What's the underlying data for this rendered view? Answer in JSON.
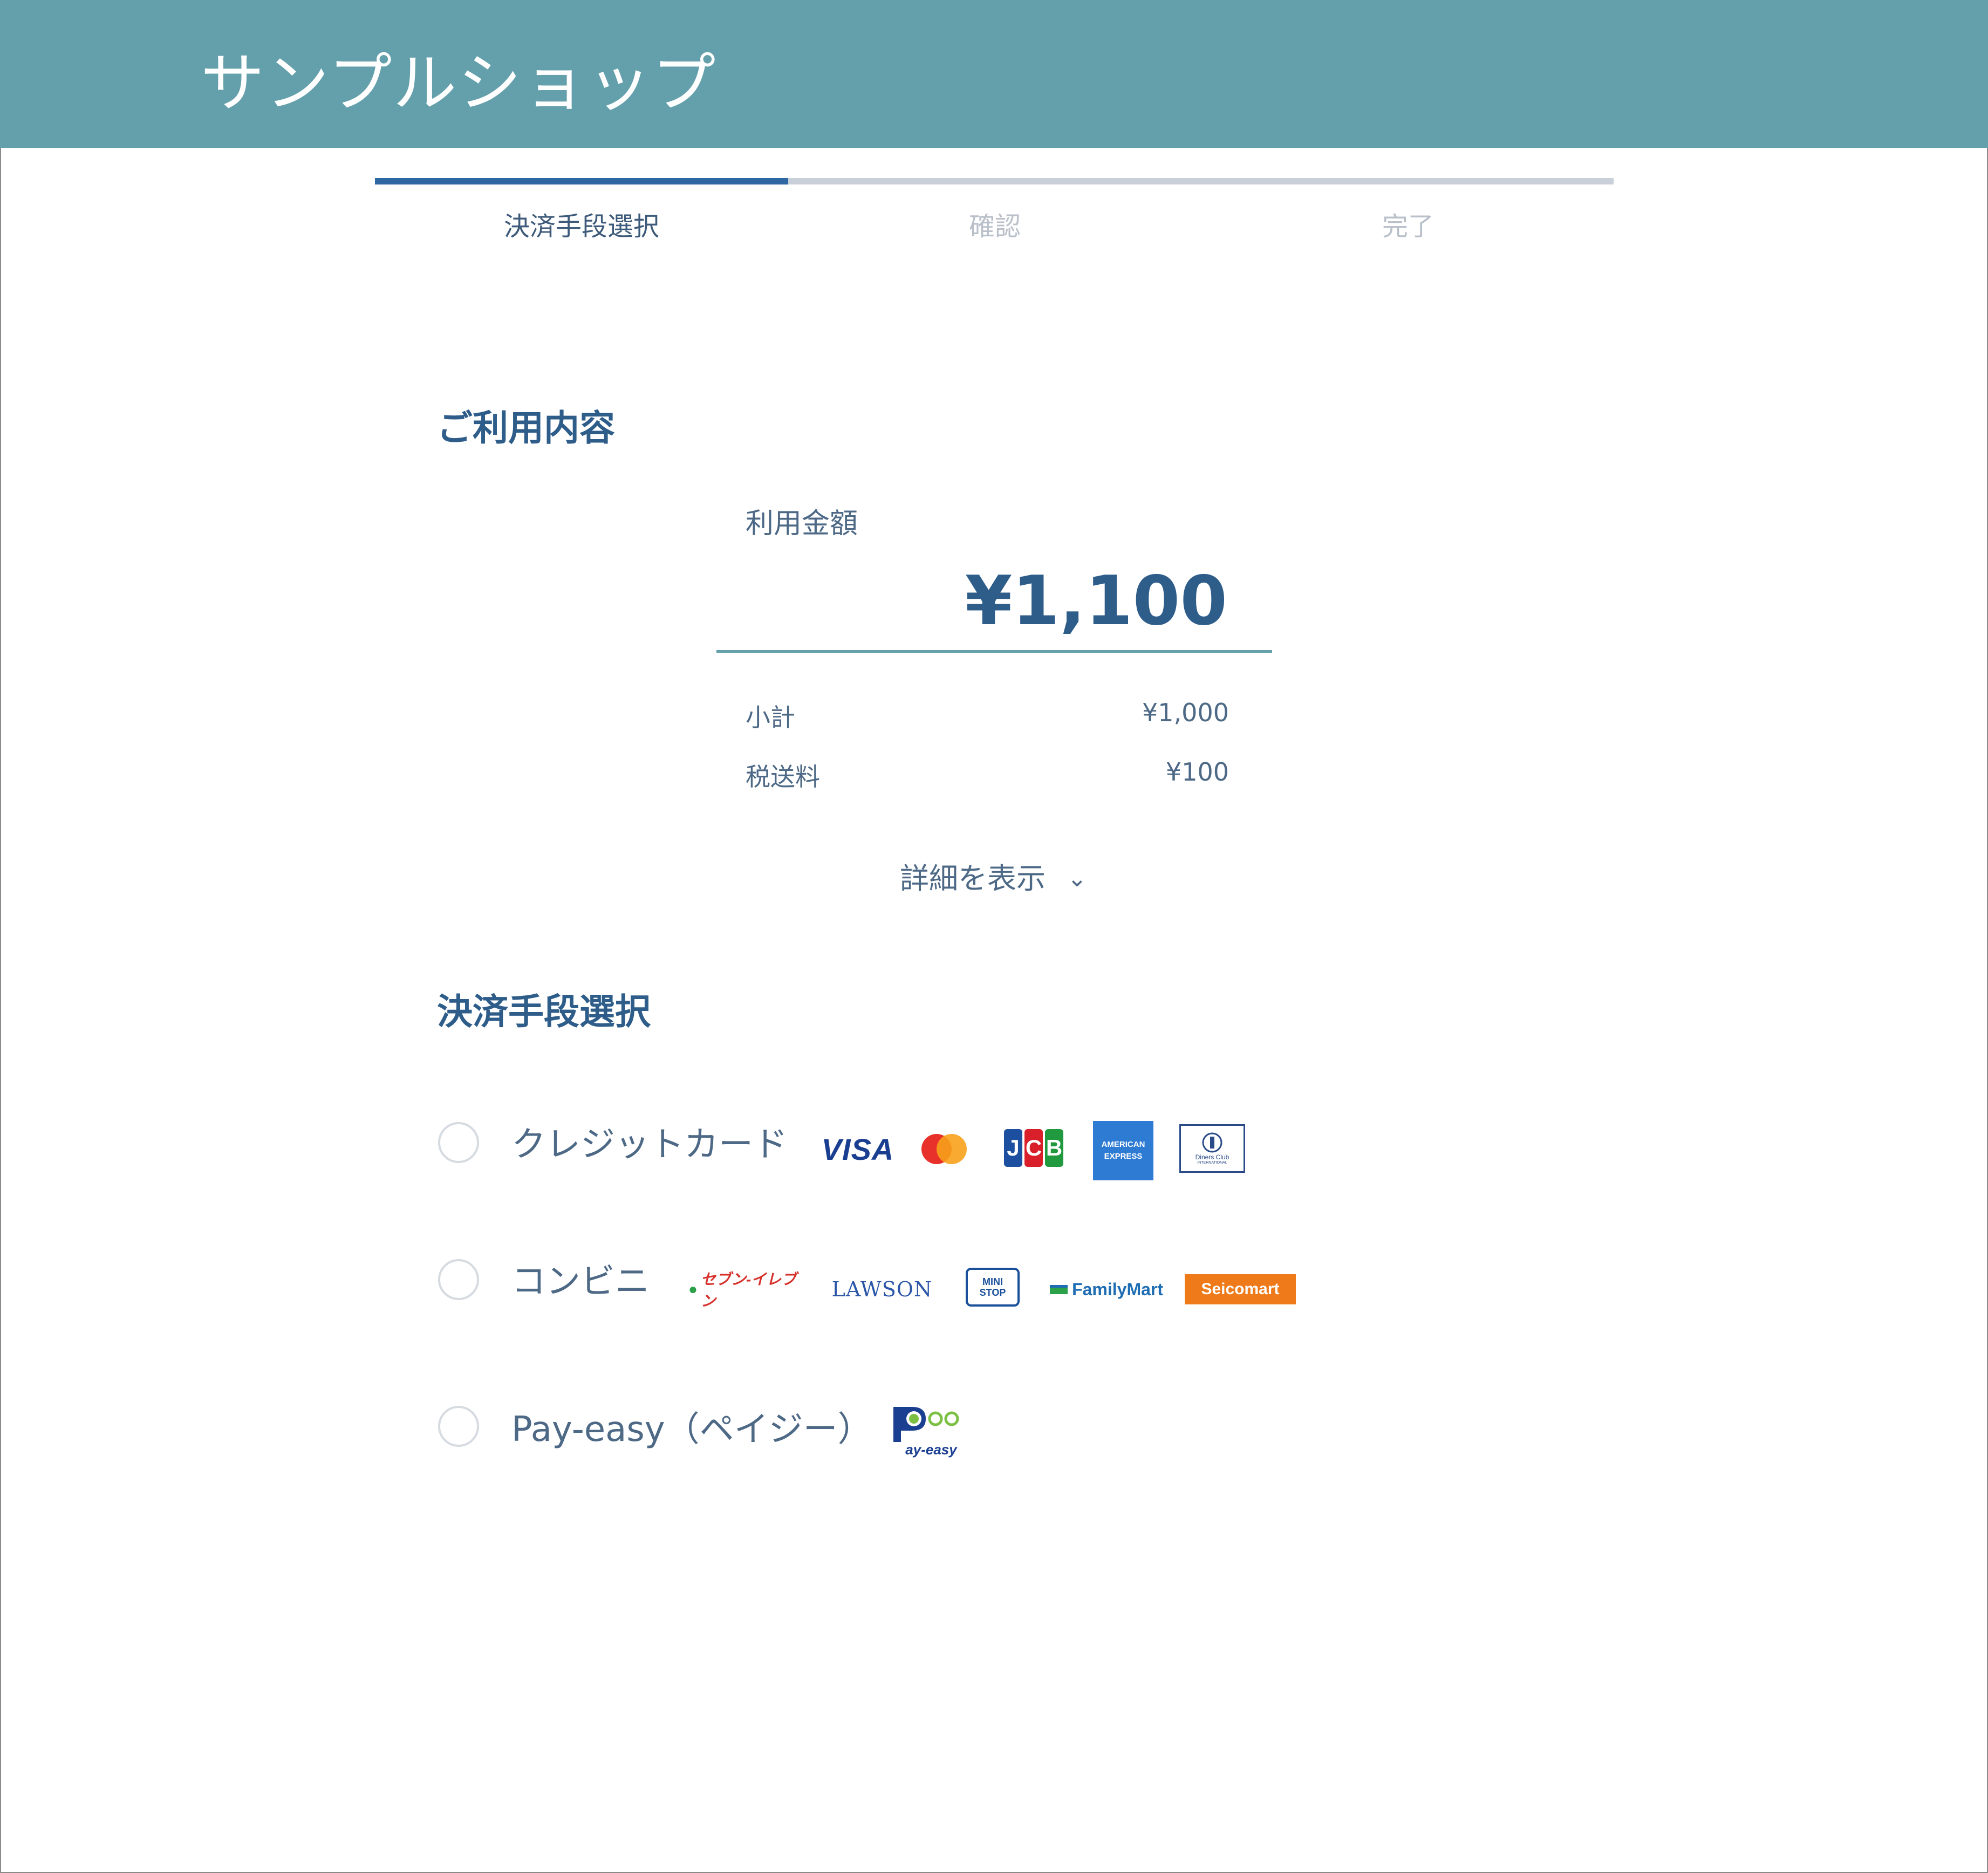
{
  "header": {
    "shop_name": "サンプルショップ"
  },
  "steps": [
    {
      "label": "決済手段選択",
      "state": "active"
    },
    {
      "label": "確認",
      "state": "inactive"
    },
    {
      "label": "完了",
      "state": "inactive"
    }
  ],
  "progress": {
    "completed_steps": 1,
    "total_steps": 3
  },
  "summary": {
    "title": "ご利用内容",
    "amount_label": "利用金額",
    "amount_value": "¥1,100",
    "rows": [
      {
        "label": "小計",
        "value": "¥1,000"
      },
      {
        "label": "税送料",
        "value": "¥100"
      }
    ],
    "details_toggle": "詳細を表示"
  },
  "payment": {
    "title": "決済手段選択",
    "methods": [
      {
        "label": "クレジットカード",
        "selected": false
      },
      {
        "label": "コンビニ",
        "selected": false
      },
      {
        "label": "Pay-easy（ペイジー）",
        "selected": false
      }
    ],
    "logos": {
      "visa": "VISA",
      "jcb": [
        "J",
        "C",
        "B"
      ],
      "amex": [
        "AMERICAN",
        "EXPRESS"
      ],
      "diners": [
        "Diners Club",
        "INTERNATIONAL"
      ],
      "seven": "セブン-イレブン",
      "lawson": "LAWSON",
      "ministop": [
        "MINI",
        "STOP"
      ],
      "famima": "FamilyMart",
      "seicomart": "Seicomart",
      "payeasy": "ay-easy"
    }
  },
  "colors": {
    "header_bg": "#64a0ab",
    "accent": "#2f67a3",
    "text": "#4d6986",
    "inactive": "#b9c0c9"
  }
}
